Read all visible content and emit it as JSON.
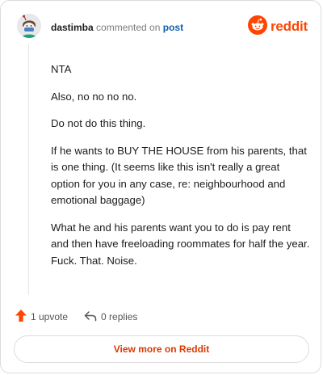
{
  "header": {
    "author": "dastimba",
    "action": "commented on",
    "post_link": "post",
    "brand": "reddit"
  },
  "comment": {
    "paragraphs": [
      "NTA",
      "Also, no no no no.",
      "Do not do this thing.",
      "If he wants to BUY THE HOUSE from his parents, that is one thing. (It seems like this isn't really a great option for you in any case, re: neighbourhood and emotional baggage)",
      "What he and his parents want you to do is pay rent and then have freeloading roommates for half the year. Fuck. That. Noise."
    ]
  },
  "footer": {
    "upvotes_label": "1 upvote",
    "replies_label": "0 replies"
  },
  "cta": {
    "label": "View more on Reddit"
  },
  "colors": {
    "brand": "#ff4500",
    "link": "#0f5fa8",
    "cta_text": "#d93a00"
  },
  "icons": {
    "avatar": "user-avatar",
    "brand": "reddit-logo-icon",
    "upvote": "upvote-arrow-icon",
    "reply": "reply-arrow-icon"
  }
}
